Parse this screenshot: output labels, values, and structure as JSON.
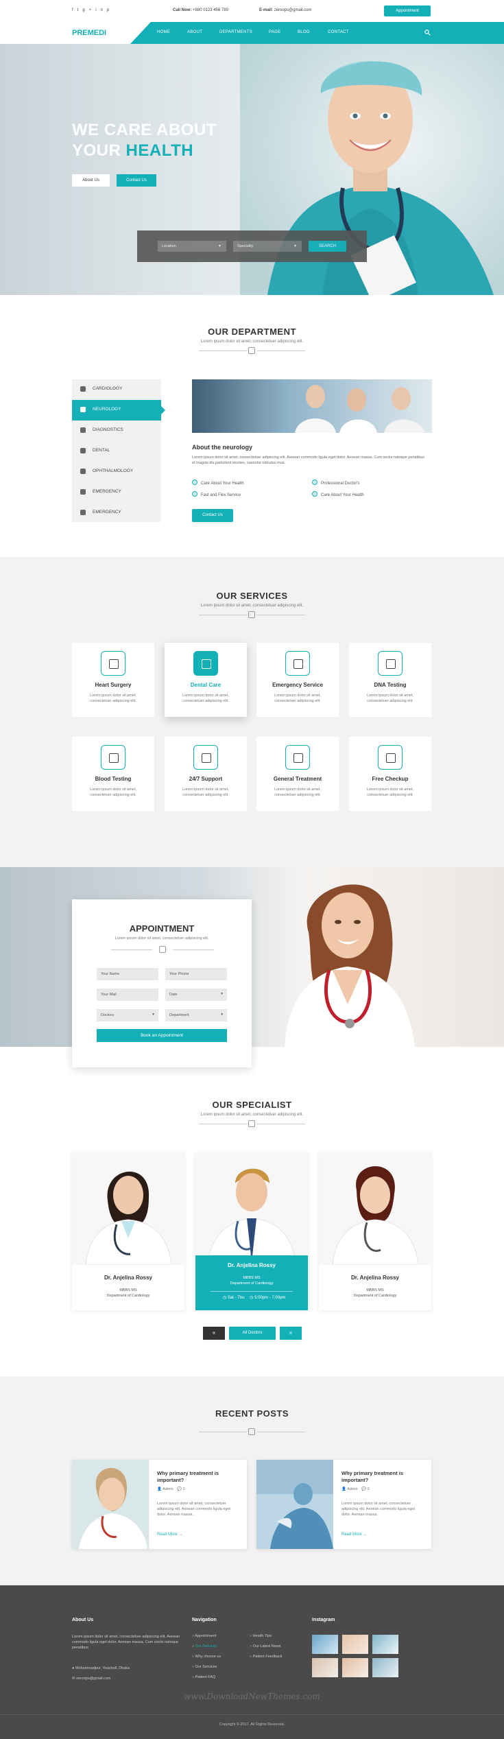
{
  "topbar": {
    "social": [
      "f",
      "t",
      "g+",
      "in",
      "p"
    ],
    "call_label": "Call Now:",
    "call_value": "+880 0123 456 789",
    "email_label": "E-mail:",
    "email_value": "zeroops@gmail.com",
    "appointment_button": "Appointment"
  },
  "nav": {
    "logo": "PREMEDI",
    "items": [
      "HOME",
      "ABOUT",
      "DEPARTMENTS",
      "PAGE",
      "BLOG",
      "CONTACT"
    ]
  },
  "hero": {
    "title_line1": "WE CARE ABOUT",
    "title_line2_a": "YOUR ",
    "title_line2_b": "HEALTH",
    "btn_about": "About Us",
    "btn_contact": "Contact Us",
    "search": {
      "location": "Location",
      "speciality": "Speciality",
      "button": "SEARCH"
    }
  },
  "department": {
    "title": "OUR DEPARTMENT",
    "subtitle": "Lorem ipsum dolor sit amet, consectetuer adipiscing elit.",
    "items": [
      "CARDIOLOGY",
      "NEUROLOGY",
      "DIAGNOSTICS",
      "DENTAL",
      "OPHTHALMOLOGY",
      "EMERGENCY",
      "EMERGENCY"
    ],
    "active_index": 1,
    "content": {
      "heading": "About the neurology",
      "text": "Lorem ipsum dolor sit amet, consectetuer adipiscing elit. Aenean commodo ligula eget dolor. Aenean massa. Cum sociis natoque penatibus et magnis dis parturient montes, nascetur ridiculus mus.",
      "checks": [
        "Care About Your Health",
        "Professional Doctor's",
        "Fast and Flex Service",
        "Care About Your Health"
      ],
      "button": "Contact Us"
    }
  },
  "services": {
    "title": "OUR SERVICES",
    "subtitle": "Lorem ipsum dolor sit amet, consectetuer adipiscing elit.",
    "items": [
      {
        "title": "Heart Surgery",
        "desc": "Lorem ipsum dolor sit amet, consectetuer adipiscing elit."
      },
      {
        "title": "Dental Care",
        "desc": "Lorem ipsum dolor sit amet, consectetuer adipiscing elit."
      },
      {
        "title": "Emergency Service",
        "desc": "Lorem ipsum dolor sit amet, consectetuer adipiscing elit."
      },
      {
        "title": "DNA Testing",
        "desc": "Lorem ipsum dolor sit amet, consectetuer adipiscing elit."
      },
      {
        "title": "Blood Testing",
        "desc": "Lorem ipsum dolor sit amet, consectetuer adipiscing elit."
      },
      {
        "title": "24/7 Support",
        "desc": "Lorem ipsum dolor sit amet, consectetuer adipiscing elit."
      },
      {
        "title": "General Treatment",
        "desc": "Lorem ipsum dolor sit amet, consectetuer adipiscing elit."
      },
      {
        "title": "Free Checkup",
        "desc": "Lorem ipsum dolor sit amet, consectetuer adipiscing elit."
      }
    ]
  },
  "appointment": {
    "title": "APPOINTMENT",
    "subtitle": "Lorem ipsum dolor sit amet, consectetuer adipiscing elit.",
    "name_placeholder": "Your Name",
    "phone_placeholder": "Your Phone",
    "mail_placeholder": "Your Mail",
    "date_placeholder": "Date",
    "doctors_select": "Doctors",
    "department_select": "Department",
    "button": "Book an Appointment"
  },
  "specialist": {
    "title": "OUR SPECIALIST",
    "subtitle": "Lorem ipsum dolor sit amet, consectetuer adipiscing elit.",
    "doctors": [
      {
        "name": "Dr. Anjelina Rossy",
        "degree": "MBBS MS",
        "dept": "Department of Cardiology"
      },
      {
        "name": "Dr. Anjelina Rossy",
        "degree": "MBBS MS",
        "dept": "Department of Cardiology",
        "schedule": "Sat - Thu",
        "hours": "5:00pm - 7:00pm"
      },
      {
        "name": "Dr. Anjelina Rossy",
        "degree": "MBBS MS",
        "dept": "Department of Cardiology"
      }
    ],
    "prev": "«",
    "all": "All Doctors",
    "next": "»"
  },
  "posts": {
    "title": "RECENT POSTS",
    "items": [
      {
        "title": "Why primary treatment is important?",
        "author": "Admin",
        "comments": "0",
        "text": "Lorem ipsum dolor sit amet, consectetuer adipiscing elit. Aenean commodo ligula eget dolor. Aenean massa.",
        "more": "Read More"
      },
      {
        "title": "Why primary treatment is important?",
        "author": "Admin",
        "comments": "0",
        "text": "Lorem ipsum dolor sit amet, consectetuer adipiscing elit. Aenean commodo ligula eget dolor. Aenean massa.",
        "more": "Read More"
      }
    ]
  },
  "footer": {
    "about_title": "About Us",
    "about_text": "Lorem ipsum dolor sit amet, consectetuer adipiscing elit. Aenean commodo ligula eget dolor. Aenean massa. Cum sociis natoque penatibus",
    "address": "Mohammadpur, Yeachall, Dhaka",
    "email": "zeroops@gmail.com",
    "nav_title": "Navigation",
    "nav_col1": [
      "Appointment",
      "Our Services",
      "Why choose us",
      "Our Services",
      "Patient FAQ"
    ],
    "nav_col2": [
      "Health Tips",
      "Our Latest News",
      "Patient Feedback"
    ],
    "instagram_title": "Instagram",
    "watermark": "www.DownloadNewThemes.com",
    "copyright": "Copyright © 2017. All Rights Reserved."
  },
  "colors": {
    "accent": "#14b0b8",
    "footer": "#4a4a4a",
    "section_bg": "#f2f2f2"
  }
}
